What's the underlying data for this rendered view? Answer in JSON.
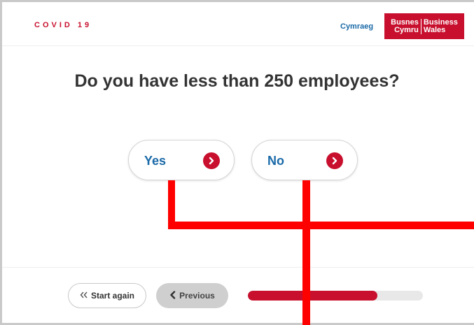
{
  "header": {
    "brand": "COVID 19",
    "language_link": "Cymraeg",
    "logo_left": [
      "Busnes",
      "Cymru"
    ],
    "logo_right": [
      "Business",
      "Wales"
    ]
  },
  "question": "Do you have less than 250 employees?",
  "answers": [
    {
      "label": "Yes",
      "icon": "chevron-right-icon"
    },
    {
      "label": "No",
      "icon": "chevron-right-icon"
    }
  ],
  "footer": {
    "start_again": "Start again",
    "previous": "Previous",
    "progress": 0.74
  },
  "colors": {
    "brand_red": "#c8102e",
    "link_blue": "#1a6aa8",
    "annotation_red": "#ff0000"
  }
}
